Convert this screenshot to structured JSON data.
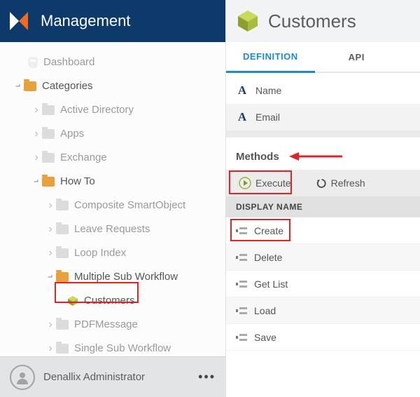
{
  "sidebar": {
    "title": "Management",
    "tree": {
      "dashboard": "Dashboard",
      "categories": "Categories",
      "active_directory": "Active Directory",
      "apps": "Apps",
      "exchange": "Exchange",
      "how_to": "How To",
      "composite": "Composite SmartObject",
      "leave": "Leave Requests",
      "loop": "Loop Index",
      "multiple": "Multiple Sub Workflow",
      "customers": "Customers",
      "pdf": "PDFMessage",
      "single": "Single Sub Workflow"
    }
  },
  "user": {
    "name": "Denallix Administrator"
  },
  "main": {
    "title": "Customers",
    "tabs": {
      "definition": "DEFINITION",
      "api": "API"
    },
    "fields": {
      "name": "Name",
      "email": "Email"
    },
    "methods_label": "Methods",
    "toolbar": {
      "execute": "Execute",
      "refresh": "Refresh"
    },
    "column_header": "DISPLAY NAME",
    "methods": {
      "create": "Create",
      "delete": "Delete",
      "getlist": "Get List",
      "load": "Load",
      "save": "Save"
    }
  }
}
